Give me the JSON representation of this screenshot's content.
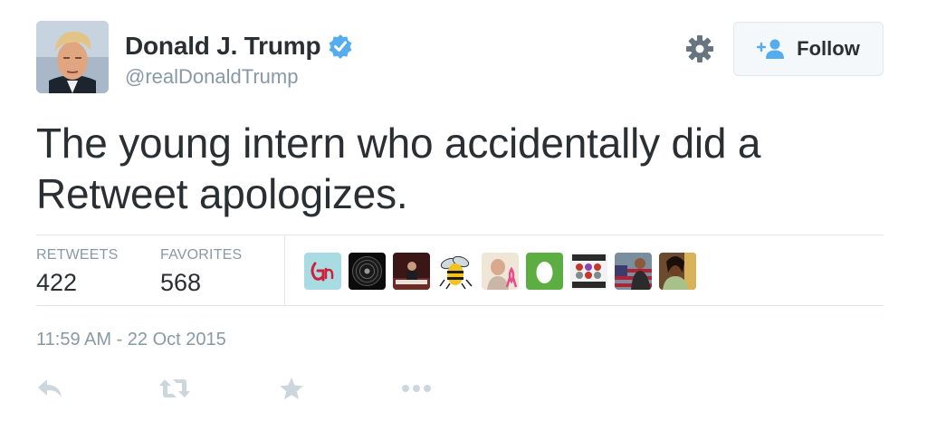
{
  "user": {
    "name": "Donald J. Trump",
    "handle": "@realDonaldTrump"
  },
  "header": {
    "follow_label": "Follow"
  },
  "tweet": {
    "text": "The young intern who accidentally did a Retweet apologizes.",
    "timestamp": "11:59 AM - 22 Oct 2015"
  },
  "stats": {
    "retweets_label": "RETWEETS",
    "retweets_count": "422",
    "favorites_label": "FAVORITES",
    "favorites_count": "568"
  },
  "favoriters": [
    "avatar-monogram-pink",
    "avatar-vinyl-record",
    "avatar-dark-photo",
    "avatar-hornet",
    "avatar-pink-ribbon",
    "avatar-default-egg",
    "avatar-collage",
    "avatar-flag-photo",
    "avatar-portrait"
  ],
  "colors": {
    "text": "#292f33",
    "muted": "#8899a6",
    "verified": "#55acee",
    "border": "#e1e8ed",
    "button_bg": "#f5f8fa",
    "icon_gray": "#ccd6dd"
  },
  "icons": [
    "verified-badge-icon",
    "gear-icon",
    "follow-person-icon",
    "reply-icon",
    "retweet-icon",
    "favorite-star-icon",
    "more-dots-icon"
  ]
}
